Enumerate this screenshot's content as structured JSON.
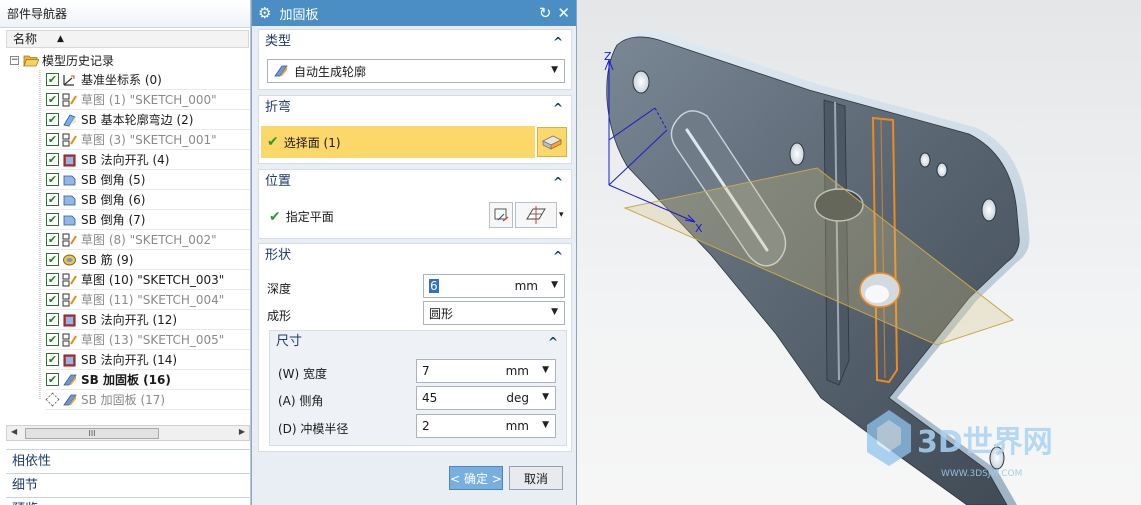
{
  "navigator": {
    "title": "部件导航器",
    "column_name": "名称",
    "root_label": "模型历史记录",
    "items": [
      {
        "label": "基准坐标系 (0)",
        "state": "normal",
        "icon": "datum-csys-icon"
      },
      {
        "label": "草图 (1) \"SKETCH_000\"",
        "state": "gray",
        "icon": "sketch-icon"
      },
      {
        "label": "SB 基本轮廓弯边 (2)",
        "state": "normal",
        "icon": "contour-flange-icon"
      },
      {
        "label": "草图 (3) \"SKETCH_001\"",
        "state": "gray",
        "icon": "sketch-icon"
      },
      {
        "label": "SB 法向开孔 (4)",
        "state": "normal",
        "icon": "normal-cutout-icon"
      },
      {
        "label": "SB 倒角 (5)",
        "state": "normal",
        "icon": "chamfer-icon"
      },
      {
        "label": "SB 倒角 (6)",
        "state": "normal",
        "icon": "chamfer-icon"
      },
      {
        "label": "SB 倒角 (7)",
        "state": "normal",
        "icon": "chamfer-icon"
      },
      {
        "label": "草图 (8) \"SKETCH_002\"",
        "state": "gray",
        "icon": "sketch-icon"
      },
      {
        "label": "SB 筋 (9)",
        "state": "normal",
        "icon": "bead-icon"
      },
      {
        "label": "草图 (10) \"SKETCH_003\"",
        "state": "normal",
        "icon": "sketch-icon"
      },
      {
        "label": "草图 (11) \"SKETCH_004\"",
        "state": "gray",
        "icon": "sketch-icon"
      },
      {
        "label": "SB 法向开孔 (12)",
        "state": "normal",
        "icon": "normal-cutout-icon"
      },
      {
        "label": "草图 (13) \"SKETCH_005\"",
        "state": "gray",
        "icon": "sketch-icon"
      },
      {
        "label": "SB 法向开孔 (14)",
        "state": "normal",
        "icon": "normal-cutout-icon"
      },
      {
        "label": "SB 加固板 (16)",
        "state": "bold",
        "icon": "gusset-icon"
      },
      {
        "label": "SB 加固板 (17)",
        "state": "pending",
        "icon": "gusset-icon"
      }
    ],
    "scroll_thumb": "III",
    "sections": [
      "相依性",
      "细节",
      "预览"
    ]
  },
  "dialog": {
    "title": "加固板",
    "type_group": {
      "header": "类型",
      "value": "自动生成轮廓"
    },
    "bend_group": {
      "header": "折弯",
      "select_label": "选择面 (1)"
    },
    "position_group": {
      "header": "位置",
      "label": "指定平面"
    },
    "shape_group": {
      "header": "形状",
      "depth_label": "深度",
      "depth_value": "6",
      "depth_unit": "mm",
      "form_label": "成形",
      "form_value": "圆形",
      "dims": {
        "header": "尺寸",
        "width_label": "(W) 宽度",
        "width_value": "7",
        "width_unit": "mm",
        "angle_label": "(A) 侧角",
        "angle_value": "45",
        "angle_unit": "deg",
        "radius_label": "(D) 冲模半径",
        "radius_value": "2",
        "radius_unit": "mm"
      }
    },
    "ok_label": "< 确定 >",
    "cancel_label": "取消"
  },
  "viewport": {
    "axis_x": "X",
    "axis_z": "Z",
    "watermark_main": "3D世界网",
    "watermark_sub": "WWW.3DSJW.COM"
  },
  "colors": {
    "title_blue": "#4a8ec4",
    "selection_yellow": "#fcd86a",
    "part_gray": "#5f6b78",
    "highlight_orange": "#f08a1c",
    "plane_tan": "#d7c27a"
  }
}
